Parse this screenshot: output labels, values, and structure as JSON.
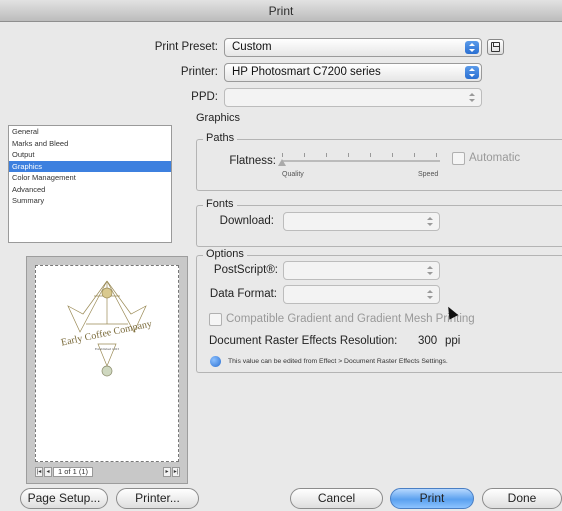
{
  "window": {
    "title": "Print"
  },
  "header": {
    "preset_label": "Print Preset:",
    "preset_value": "Custom",
    "printer_label": "Printer:",
    "printer_value": "HP Photosmart C7200 series",
    "ppd_label": "PPD:",
    "ppd_value": ""
  },
  "sidebar": {
    "items": [
      {
        "label": "General",
        "selected": false
      },
      {
        "label": "Marks and Bleed",
        "selected": false
      },
      {
        "label": "Output",
        "selected": false
      },
      {
        "label": "Graphics",
        "selected": true
      },
      {
        "label": "Color Management",
        "selected": false
      },
      {
        "label": "Advanced",
        "selected": false
      },
      {
        "label": "Summary",
        "selected": false
      }
    ]
  },
  "preview": {
    "page_count": "1 of 1 (1)",
    "artwork_text": "Early Coffee Company",
    "artwork_subtext": "Established 1923"
  },
  "graphics": {
    "section_title": "Graphics",
    "paths": {
      "legend": "Paths",
      "flatness_label": "Flatness:",
      "quality_label": "Quality",
      "speed_label": "Speed",
      "automatic_label": "Automatic",
      "automatic_checked": false
    },
    "fonts": {
      "legend": "Fonts",
      "download_label": "Download:",
      "download_value": ""
    },
    "options": {
      "legend": "Options",
      "postscript_label": "PostScript®:",
      "postscript_value": "",
      "data_format_label": "Data Format:",
      "data_format_value": "",
      "compatible_label": "Compatible Gradient and Gradient Mesh Printing",
      "compatible_checked": false,
      "raster_label": "Document Raster Effects Resolution:",
      "raster_value": "300",
      "raster_unit": "ppi",
      "note": "This value can be edited from Effect > Document Raster Effects Settings."
    }
  },
  "footer": {
    "page_setup": "Page Setup...",
    "printer": "Printer...",
    "cancel": "Cancel",
    "print": "Print",
    "done": "Done"
  },
  "colors": {
    "accent": "#3d80df",
    "primary_button": "#5ba1ef",
    "window_bg": "#e9e9e9"
  }
}
